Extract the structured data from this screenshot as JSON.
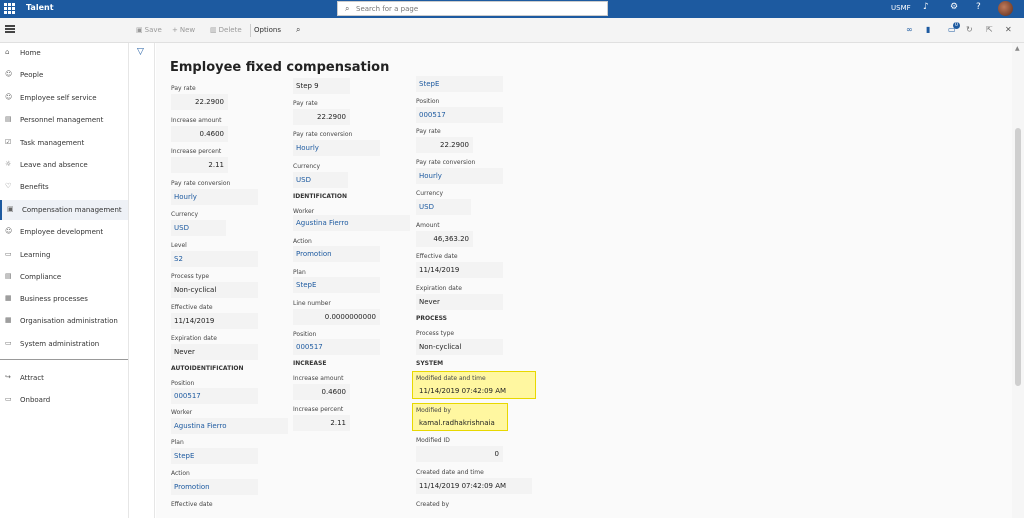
{
  "app": {
    "name": "Talent",
    "search_placeholder": "Search for a page",
    "company": "USMF"
  },
  "actionbar": {
    "save": "Save",
    "new": "New",
    "delete": "Delete",
    "options": "Options",
    "notification_count": "0"
  },
  "nav": [
    {
      "icon": "home-icon",
      "glyph": "⌂",
      "label": "Home"
    },
    {
      "icon": "people-icon",
      "glyph": "☺",
      "label": "People"
    },
    {
      "icon": "self-service-icon",
      "glyph": "☺",
      "label": "Employee self service"
    },
    {
      "icon": "personnel-icon",
      "glyph": "▤",
      "label": "Personnel management"
    },
    {
      "icon": "task-icon",
      "glyph": "☑",
      "label": "Task management"
    },
    {
      "icon": "leave-icon",
      "glyph": "☼",
      "label": "Leave and absence"
    },
    {
      "icon": "benefits-icon",
      "glyph": "♡",
      "label": "Benefits"
    },
    {
      "icon": "compensation-icon",
      "glyph": "▣",
      "label": "Compensation management"
    },
    {
      "icon": "development-icon",
      "glyph": "☺",
      "label": "Employee development"
    },
    {
      "icon": "learning-icon",
      "glyph": "▭",
      "label": "Learning"
    },
    {
      "icon": "compliance-icon",
      "glyph": "▤",
      "label": "Compliance"
    },
    {
      "icon": "business-process-icon",
      "glyph": "▦",
      "label": "Business processes"
    },
    {
      "icon": "org-admin-icon",
      "glyph": "▦",
      "label": "Organisation administration"
    },
    {
      "icon": "system-admin-icon",
      "glyph": "▭",
      "label": "System administration"
    },
    {
      "icon": "attract-icon",
      "glyph": "↪",
      "label": "Attract"
    },
    {
      "icon": "onboard-icon",
      "glyph": "▭",
      "label": "Onboard"
    }
  ],
  "page": {
    "title": "Employee fixed compensation"
  },
  "col1": {
    "pay_rate_label": "Pay rate",
    "pay_rate": "22.2900",
    "increase_amount_label": "Increase amount",
    "increase_amount": "0.4600",
    "increase_percent_label": "Increase percent",
    "increase_percent": "2.11",
    "pay_rate_conversion_label": "Pay rate conversion",
    "pay_rate_conversion": "Hourly",
    "currency_label": "Currency",
    "currency": "USD",
    "level_label": "Level",
    "level": "S2",
    "process_type_label": "Process type",
    "process_type": "Non-cyclical",
    "effective_date_label": "Effective date",
    "effective_date": "11/14/2019",
    "expiration_date_label": "Expiration date",
    "expiration_date": "Never",
    "autoidentification": "AUTOIDENTIFICATION",
    "position_label": "Position",
    "position": "000517",
    "worker_label": "Worker",
    "worker": "Agustina Fierro",
    "plan_label": "Plan",
    "plan": "StepE",
    "action_label": "Action",
    "action": "Promotion",
    "effective_date2_label": "Effective date"
  },
  "col2": {
    "step": "Step 9",
    "pay_rate_label": "Pay rate",
    "pay_rate": "22.2900",
    "pay_rate_conversion_label": "Pay rate conversion",
    "pay_rate_conversion": "Hourly",
    "currency_label": "Currency",
    "currency": "USD",
    "identification": "IDENTIFICATION",
    "worker_label": "Worker",
    "worker": "Agustina Fierro",
    "action_label": "Action",
    "action": "Promotion",
    "plan_label": "Plan",
    "plan": "StepE",
    "line_number_label": "Line number",
    "line_number": "0.0000000000",
    "position_label": "Position",
    "position": "000517",
    "increase": "INCREASE",
    "increase_amount_label": "Increase amount",
    "increase_amount": "0.4600",
    "increase_percent_label": "Increase percent",
    "increase_percent": "2.11"
  },
  "col3": {
    "step": "StepE",
    "position_label": "Position",
    "position": "000517",
    "pay_rate_label": "Pay rate",
    "pay_rate": "22.2900",
    "pay_rate_conversion_label": "Pay rate conversion",
    "pay_rate_conversion": "Hourly",
    "currency_label": "Currency",
    "currency": "USD",
    "amount_label": "Amount",
    "amount": "46,363.20",
    "effective_date_label": "Effective date",
    "effective_date": "11/14/2019",
    "expiration_date_label": "Expiration date",
    "expiration_date": "Never",
    "process": "PROCESS",
    "process_type_label": "Process type",
    "process_type": "Non-cyclical",
    "system": "SYSTEM",
    "modified_dt_label": "Modified date and time",
    "modified_dt": "11/14/2019 07:42:09 AM",
    "modified_by_label": "Modified by",
    "modified_by": "kamal.radhakrishnaia",
    "modified_id_label": "Modified ID",
    "modified_id": "0",
    "created_dt_label": "Created date and time",
    "created_dt": "11/14/2019 07:42:09 AM",
    "created_by_label": "Created by"
  },
  "colors": {
    "brand": "#1d5aa0",
    "highlight": "#fff7a0"
  }
}
